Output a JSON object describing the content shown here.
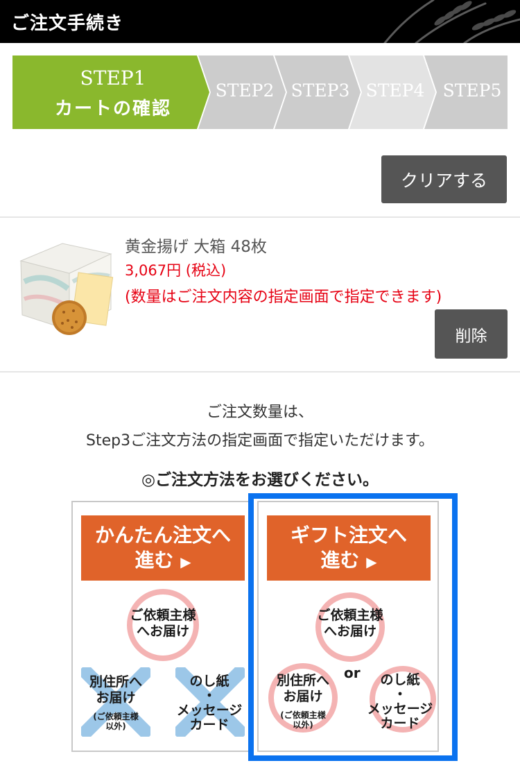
{
  "header": {
    "title": "ご注文手続き"
  },
  "steps": [
    {
      "label": "STEP1",
      "sub": "カートの確認",
      "state": "active"
    },
    {
      "label": "STEP2",
      "state": "inactive"
    },
    {
      "label": "STEP3",
      "state": "inactive"
    },
    {
      "label": "STEP4",
      "state": "disabled"
    },
    {
      "label": "STEP5",
      "state": "inactive"
    }
  ],
  "clear_button": "クリアする",
  "product": {
    "name": "黄金揚げ 大箱 48枚",
    "price": "3,067円 (税込)",
    "note": "(数量はご注文内容の指定画面で指定できます)",
    "delete_button": "削除"
  },
  "info": {
    "line1": "ご注文数量は、",
    "line2": "Step3ご注文方法の指定画面で指定いただけます。",
    "choose": "◎ご注文方法をお選びください。"
  },
  "options": [
    {
      "button_line1": "かんたん注文へ",
      "button_line2": "進む",
      "requester": "ご依頼主様\nへお届け",
      "other_address": "別住所へ\nお届け",
      "other_address_note": "(ご依頼主様\n以外)",
      "noshi": "のし紙\n・\nメッセージ\nカード"
    },
    {
      "button_line1": "ギフト注文へ",
      "button_line2": "進む",
      "requester": "ご依頼主様\nへお届け",
      "other_address": "別住所へ\nお届け",
      "other_address_note": "(ご依頼主様\n以外)",
      "or": "or",
      "noshi": "のし紙\n・\nメッセージ\nカード"
    }
  ],
  "colors": {
    "active_step": "#8ab82d",
    "inactive_step": "#cccccc",
    "price_red": "#e60012",
    "order_button": "#e0632a",
    "highlight": "#0a72ef"
  }
}
